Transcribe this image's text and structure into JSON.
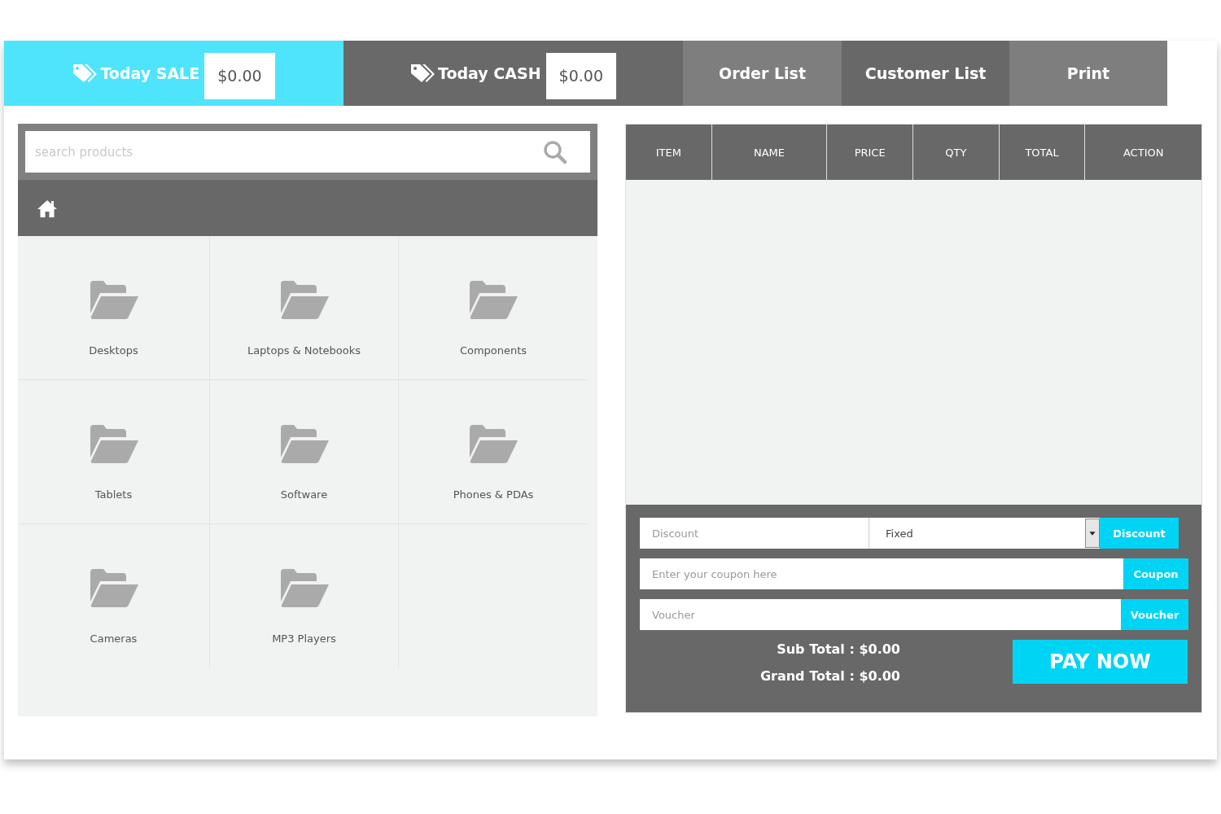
{
  "stats": [
    {
      "kind": "sale",
      "label": "Today SALE",
      "value": "$0.00"
    },
    {
      "kind": "cash",
      "label": "Today CASH",
      "value": "$0.00"
    }
  ],
  "nav": [
    "Order List",
    "Customer List",
    "Print"
  ],
  "search": {
    "placeholder": "search products"
  },
  "categories": [
    "Desktops",
    "Laptops & Notebooks",
    "Components",
    "Tablets",
    "Software",
    "Phones & PDAs",
    "Cameras",
    "MP3 Players"
  ],
  "cart": {
    "columns": [
      "ITEM",
      "NAME",
      "PRICE",
      "QTY",
      "TOTAL",
      "ACTION"
    ]
  },
  "discount": {
    "placeholder": "Discount",
    "type": "Fixed",
    "button": "Discount"
  },
  "coupon": {
    "placeholder": "Enter your coupon here",
    "button": "Coupon"
  },
  "voucher": {
    "placeholder": "Voucher",
    "button": "Voucher"
  },
  "totals": {
    "sub_total": "Sub Total : $0.00",
    "grand_total": "Grand Total : $0.00"
  },
  "pay_button": "PAY NOW"
}
